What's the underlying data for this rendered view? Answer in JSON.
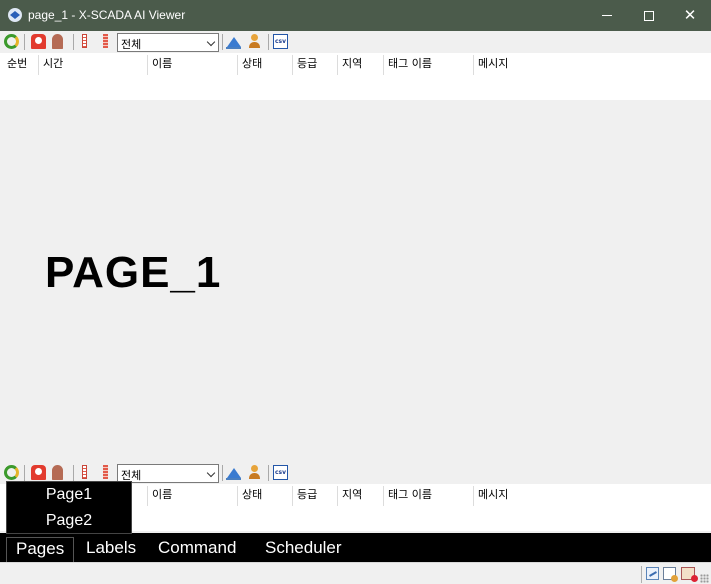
{
  "window": {
    "title": "page_1 - X-SCADA AI Viewer",
    "min_symbol": "",
    "max_symbol": "",
    "close_symbol": "✕"
  },
  "toolbar": {
    "filter_value": "전체",
    "csv_label": "csv",
    "icons": [
      "refresh-icon",
      "alarm-icon",
      "siren-icon",
      "tag-red-icon",
      "tag-striped-icon",
      "trend-icon",
      "user-icon",
      "csv-export-icon"
    ]
  },
  "alarm_columns": [
    "순번",
    "시간",
    "이름",
    "상태",
    "등급",
    "지역",
    "태그 이름",
    "메시지"
  ],
  "canvas": {
    "page_label": "PAGE_1"
  },
  "popup_menu": {
    "items": [
      "Page1",
      "Page2"
    ]
  },
  "tabs": [
    "Pages",
    "Labels",
    "Command",
    "Scheduler"
  ],
  "active_tab": "Pages",
  "status_icons": [
    "network-icon",
    "document-icon",
    "error-icon"
  ],
  "colors": {
    "titlebar": "#4b5b4b",
    "tabbar": "#000000",
    "canvas": "#f0f0f0"
  }
}
